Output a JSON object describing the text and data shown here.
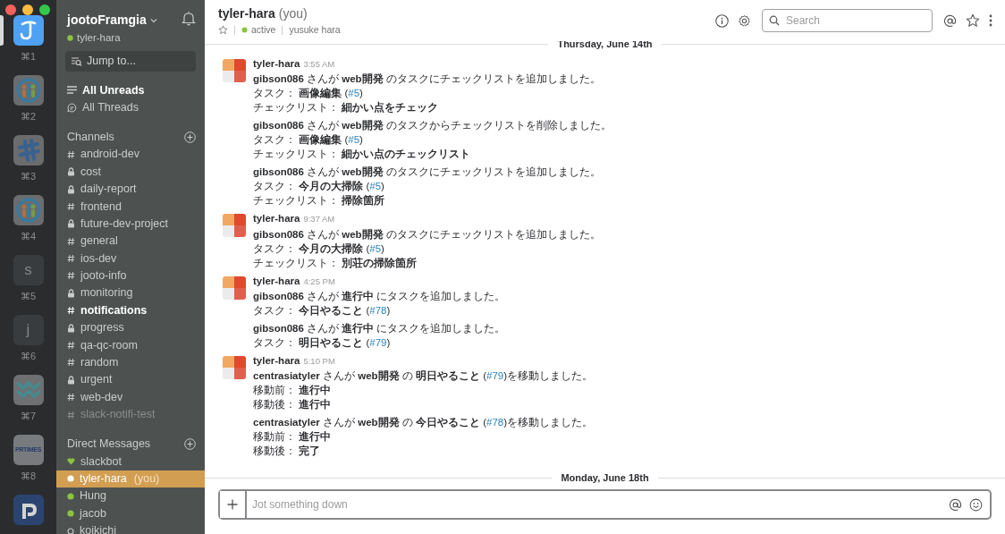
{
  "workspaces": [
    {
      "kind": "logo-j",
      "shortcut": "⌘1",
      "selected": true
    },
    {
      "kind": "people",
      "shortcut": "⌘2",
      "selected": false
    },
    {
      "kind": "hash",
      "shortcut": "⌘3",
      "selected": false
    },
    {
      "kind": "people",
      "shortcut": "⌘4",
      "selected": false
    },
    {
      "kind": "letter",
      "label": "s",
      "shortcut": "⌘5",
      "selected": false
    },
    {
      "kind": "letter",
      "label": "j",
      "shortcut": "⌘6",
      "selected": false
    },
    {
      "kind": "wave",
      "shortcut": "⌘7",
      "selected": false
    },
    {
      "kind": "wordmark",
      "label": "PRTIMES",
      "shortcut": "⌘8",
      "selected": false
    },
    {
      "kind": "tile",
      "selected": false
    }
  ],
  "sidebar": {
    "team": "jootoFramgia",
    "user": "tyler-hara",
    "jump": "Jump to...",
    "nav": [
      {
        "kind": "unreads",
        "label": "All Unreads",
        "unread": true
      },
      {
        "kind": "threads",
        "label": "All Threads",
        "unread": false
      }
    ],
    "channels_title": "Channels",
    "channels": [
      {
        "name": "android-dev",
        "private": false,
        "unread": false,
        "muted": false
      },
      {
        "name": "cost",
        "private": true,
        "unread": false,
        "muted": false
      },
      {
        "name": "daily-report",
        "private": true,
        "unread": false,
        "muted": false
      },
      {
        "name": "frontend",
        "private": false,
        "unread": false,
        "muted": false
      },
      {
        "name": "future-dev-project",
        "private": true,
        "unread": false,
        "muted": false
      },
      {
        "name": "general",
        "private": false,
        "unread": false,
        "muted": false
      },
      {
        "name": "ios-dev",
        "private": false,
        "unread": false,
        "muted": false
      },
      {
        "name": "jooto-info",
        "private": false,
        "unread": false,
        "muted": false
      },
      {
        "name": "monitoring",
        "private": true,
        "unread": false,
        "muted": false
      },
      {
        "name": "notifications",
        "private": false,
        "unread": true,
        "muted": false
      },
      {
        "name": "progress",
        "private": true,
        "unread": false,
        "muted": false
      },
      {
        "name": "qa-qc-room",
        "private": false,
        "unread": false,
        "muted": false
      },
      {
        "name": "random",
        "private": false,
        "unread": false,
        "muted": false
      },
      {
        "name": "urgent",
        "private": true,
        "unread": false,
        "muted": false
      },
      {
        "name": "web-dev",
        "private": false,
        "unread": false,
        "muted": false
      },
      {
        "name": "slack-notifi-test",
        "private": false,
        "unread": false,
        "muted": true
      }
    ],
    "dm_title": "Direct Messages",
    "dms": [
      {
        "name": "slackbot",
        "kind": "bot",
        "selected": false
      },
      {
        "name": "tyler-hara",
        "suffix": "(you)",
        "kind": "online",
        "selected": true
      },
      {
        "name": "Hung",
        "kind": "online",
        "selected": false
      },
      {
        "name": "jacob",
        "kind": "online",
        "selected": false
      },
      {
        "name": "koikichi",
        "kind": "away",
        "selected": false
      }
    ]
  },
  "header": {
    "name": "tyler-hara",
    "suffix": "(you)",
    "status": "active",
    "full_name": "yusuke hara",
    "search_placeholder": "Search"
  },
  "feed": [
    {
      "kind": "date",
      "label": "Thursday, June 14th"
    },
    {
      "kind": "group",
      "author": "tyler-hara",
      "time": "3:55 AM",
      "messages": [
        [
          [
            {
              "kind": "bold",
              "text": "gibson086"
            },
            {
              "kind": "plain",
              "text": " さんが "
            },
            {
              "kind": "bold",
              "text": "web開発"
            },
            {
              "kind": "plain",
              "text": " のタスクにチェックリストを追加しました。"
            }
          ],
          [
            {
              "kind": "plain",
              "text": "タスク： "
            },
            {
              "kind": "bold",
              "text": "画像編集"
            },
            {
              "kind": "plain",
              "text": " ("
            },
            {
              "kind": "link",
              "text": "#5"
            },
            {
              "kind": "plain",
              "text": ")"
            }
          ],
          [
            {
              "kind": "plain",
              "text": "チェックリスト： "
            },
            {
              "kind": "bold",
              "text": "細かい点をチェック"
            }
          ]
        ],
        [
          [
            {
              "kind": "bold",
              "text": "gibson086"
            },
            {
              "kind": "plain",
              "text": " さんが "
            },
            {
              "kind": "bold",
              "text": "web開発"
            },
            {
              "kind": "plain",
              "text": " のタスクからチェックリストを削除しました。"
            }
          ],
          [
            {
              "kind": "plain",
              "text": "タスク： "
            },
            {
              "kind": "bold",
              "text": "画像編集"
            },
            {
              "kind": "plain",
              "text": " ("
            },
            {
              "kind": "link",
              "text": "#5"
            },
            {
              "kind": "plain",
              "text": ")"
            }
          ],
          [
            {
              "kind": "plain",
              "text": "チェックリスト： "
            },
            {
              "kind": "bold",
              "text": "細かい点のチェックリスト"
            }
          ]
        ],
        [
          [
            {
              "kind": "bold",
              "text": "gibson086"
            },
            {
              "kind": "plain",
              "text": " さんが "
            },
            {
              "kind": "bold",
              "text": "web開発"
            },
            {
              "kind": "plain",
              "text": " のタスクにチェックリストを追加しました。"
            }
          ],
          [
            {
              "kind": "plain",
              "text": "タスク： "
            },
            {
              "kind": "bold",
              "text": "今月の大掃除"
            },
            {
              "kind": "plain",
              "text": " ("
            },
            {
              "kind": "link",
              "text": "#5"
            },
            {
              "kind": "plain",
              "text": ")"
            }
          ],
          [
            {
              "kind": "plain",
              "text": "チェックリスト： "
            },
            {
              "kind": "bold",
              "text": "掃除箇所"
            }
          ]
        ]
      ]
    },
    {
      "kind": "group",
      "author": "tyler-hara",
      "time": "9:37 AM",
      "messages": [
        [
          [
            {
              "kind": "bold",
              "text": "gibson086"
            },
            {
              "kind": "plain",
              "text": " さんが "
            },
            {
              "kind": "bold",
              "text": "web開発"
            },
            {
              "kind": "plain",
              "text": " のタスクにチェックリストを追加しました。"
            }
          ],
          [
            {
              "kind": "plain",
              "text": "タスク： "
            },
            {
              "kind": "bold",
              "text": "今月の大掃除"
            },
            {
              "kind": "plain",
              "text": " ("
            },
            {
              "kind": "link",
              "text": "#5"
            },
            {
              "kind": "plain",
              "text": ")"
            }
          ],
          [
            {
              "kind": "plain",
              "text": "チェックリスト： "
            },
            {
              "kind": "bold",
              "text": "別荘の掃除箇所"
            }
          ]
        ]
      ]
    },
    {
      "kind": "group",
      "author": "tyler-hara",
      "time": "4:25 PM",
      "messages": [
        [
          [
            {
              "kind": "bold",
              "text": "gibson086"
            },
            {
              "kind": "plain",
              "text": " さんが "
            },
            {
              "kind": "bold",
              "text": "進行中"
            },
            {
              "kind": "plain",
              "text": " にタスクを追加しました。"
            }
          ],
          [
            {
              "kind": "plain",
              "text": "タスク： "
            },
            {
              "kind": "bold",
              "text": "今日やること"
            },
            {
              "kind": "plain",
              "text": " ("
            },
            {
              "kind": "link",
              "text": "#78"
            },
            {
              "kind": "plain",
              "text": ")"
            }
          ]
        ],
        [
          [
            {
              "kind": "bold",
              "text": "gibson086"
            },
            {
              "kind": "plain",
              "text": " さんが "
            },
            {
              "kind": "bold",
              "text": "進行中"
            },
            {
              "kind": "plain",
              "text": " にタスクを追加しました。"
            }
          ],
          [
            {
              "kind": "plain",
              "text": "タスク： "
            },
            {
              "kind": "bold",
              "text": "明日やること"
            },
            {
              "kind": "plain",
              "text": " ("
            },
            {
              "kind": "link",
              "text": "#79"
            },
            {
              "kind": "plain",
              "text": ")"
            }
          ]
        ]
      ]
    },
    {
      "kind": "group",
      "author": "tyler-hara",
      "time": "5:10 PM",
      "messages": [
        [
          [
            {
              "kind": "bold",
              "text": "centrasiatyler"
            },
            {
              "kind": "plain",
              "text": " さんが "
            },
            {
              "kind": "bold",
              "text": "web開発"
            },
            {
              "kind": "plain",
              "text": " の "
            },
            {
              "kind": "bold",
              "text": "明日やること"
            },
            {
              "kind": "plain",
              "text": " ("
            },
            {
              "kind": "link",
              "text": "#79"
            },
            {
              "kind": "plain",
              "text": ")を移動しました。"
            }
          ],
          [
            {
              "kind": "plain",
              "text": "移動前： "
            },
            {
              "kind": "bold",
              "text": "進行中"
            }
          ],
          [
            {
              "kind": "plain",
              "text": "移動後： "
            },
            {
              "kind": "bold",
              "text": "進行中"
            }
          ]
        ],
        [
          [
            {
              "kind": "bold",
              "text": "centrasiatyler"
            },
            {
              "kind": "plain",
              "text": " さんが "
            },
            {
              "kind": "bold",
              "text": "web開発"
            },
            {
              "kind": "plain",
              "text": " の "
            },
            {
              "kind": "bold",
              "text": "今日やること"
            },
            {
              "kind": "plain",
              "text": " ("
            },
            {
              "kind": "link",
              "text": "#78"
            },
            {
              "kind": "plain",
              "text": ")を移動しました。"
            }
          ],
          [
            {
              "kind": "plain",
              "text": "移動前： "
            },
            {
              "kind": "bold",
              "text": "進行中"
            }
          ],
          [
            {
              "kind": "plain",
              "text": "移動後： "
            },
            {
              "kind": "bold",
              "text": "完了"
            }
          ]
        ]
      ]
    },
    {
      "kind": "date",
      "label": "Monday, June 18th"
    }
  ],
  "composer": {
    "placeholder": "Jot something down"
  }
}
